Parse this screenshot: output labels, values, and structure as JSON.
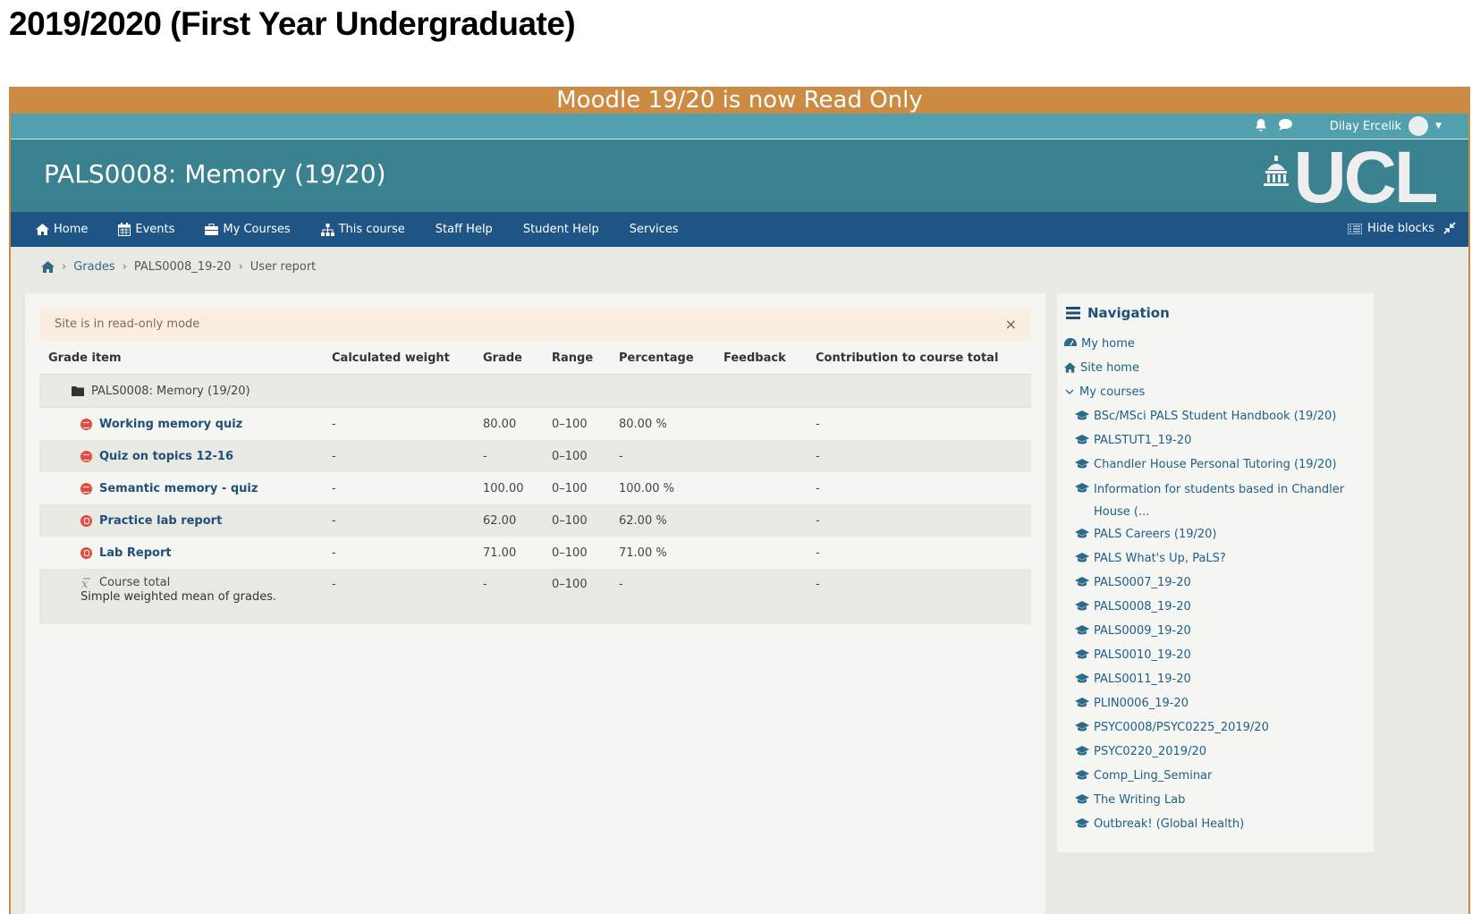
{
  "document": {
    "title": "2019/2020 (First Year Undergraduate)"
  },
  "banner": {
    "text": "Moodle 19/20 is now Read Only"
  },
  "userbar": {
    "user_name": "Dilay Ercelik"
  },
  "header": {
    "course_title": "PALS0008: Memory (19/20)",
    "logo_text": "UCL"
  },
  "navbar": {
    "items": [
      {
        "label": "Home",
        "icon": "home-icon"
      },
      {
        "label": "Events",
        "icon": "calendar-icon"
      },
      {
        "label": "My Courses",
        "icon": "briefcase-icon"
      },
      {
        "label": "This course",
        "icon": "sitemap-icon"
      },
      {
        "label": "Staff Help",
        "icon": ""
      },
      {
        "label": "Student Help",
        "icon": ""
      },
      {
        "label": "Services",
        "icon": ""
      }
    ],
    "hide_blocks": "Hide blocks"
  },
  "breadcrumb": {
    "items": [
      "Grades",
      "PALS0008_19-20",
      "User report"
    ]
  },
  "alert": {
    "text": "Site is in read-only mode",
    "close": "×"
  },
  "grades_table": {
    "headers": [
      "Grade item",
      "Calculated weight",
      "Grade",
      "Range",
      "Percentage",
      "Feedback",
      "Contribution to course total"
    ],
    "category": "PALS0008: Memory (19/20)",
    "rows": [
      {
        "name": "Working memory quiz",
        "type": "quiz",
        "weight": "-",
        "grade": "80.00",
        "range": "0–100",
        "percentage": "80.00 %",
        "feedback": "",
        "contribution": "-"
      },
      {
        "name": "Quiz on topics 12-16",
        "type": "quiz",
        "weight": "-",
        "grade": "-",
        "range": "0–100",
        "percentage": "-",
        "feedback": "",
        "contribution": "-"
      },
      {
        "name": "Semantic memory - quiz",
        "type": "quiz",
        "weight": "-",
        "grade": "100.00",
        "range": "0–100",
        "percentage": "100.00 %",
        "feedback": "",
        "contribution": "-"
      },
      {
        "name": "Practice lab report",
        "type": "assignment",
        "weight": "-",
        "grade": "62.00",
        "range": "0–100",
        "percentage": "62.00 %",
        "feedback": "",
        "contribution": "-"
      },
      {
        "name": "Lab Report",
        "type": "assignment",
        "weight": "-",
        "grade": "71.00",
        "range": "0–100",
        "percentage": "71.00 %",
        "feedback": "",
        "contribution": "-"
      }
    ],
    "total": {
      "name": "Course total",
      "description": "Simple weighted mean of grades.",
      "weight": "-",
      "grade": "-",
      "range": "0–100",
      "percentage": "-",
      "contribution": "-"
    }
  },
  "navigation": {
    "title": "Navigation",
    "my_home": "My home",
    "site_home": "Site home",
    "my_courses": "My courses",
    "courses": [
      "BSc/MSci PALS Student Handbook (19/20)",
      "PALSTUT1_19-20",
      "Chandler House Personal Tutoring (19/20)",
      "Information for students based in Chandler House (...",
      "PALS Careers (19/20)",
      "PALS What's Up, PaLS?",
      "PALS0007_19-20",
      "PALS0008_19-20",
      "PALS0009_19-20",
      "PALS0010_19-20",
      "PALS0011_19-20",
      "PLIN0006_19-20",
      "PSYC0008/PSYC0225_2019/20",
      "PSYC0220_2019/20",
      "Comp_Ling_Seminar",
      "The Writing Lab",
      "Outbreak! (Global Health)"
    ]
  },
  "colors": {
    "banner": "#cc8a42",
    "userbar": "#52a0ad",
    "header": "#3a8290",
    "navbar": "#1f5585",
    "link": "#1f4f7a",
    "alert_bg": "#fbeee0",
    "activity_icon": "#e44c41"
  }
}
